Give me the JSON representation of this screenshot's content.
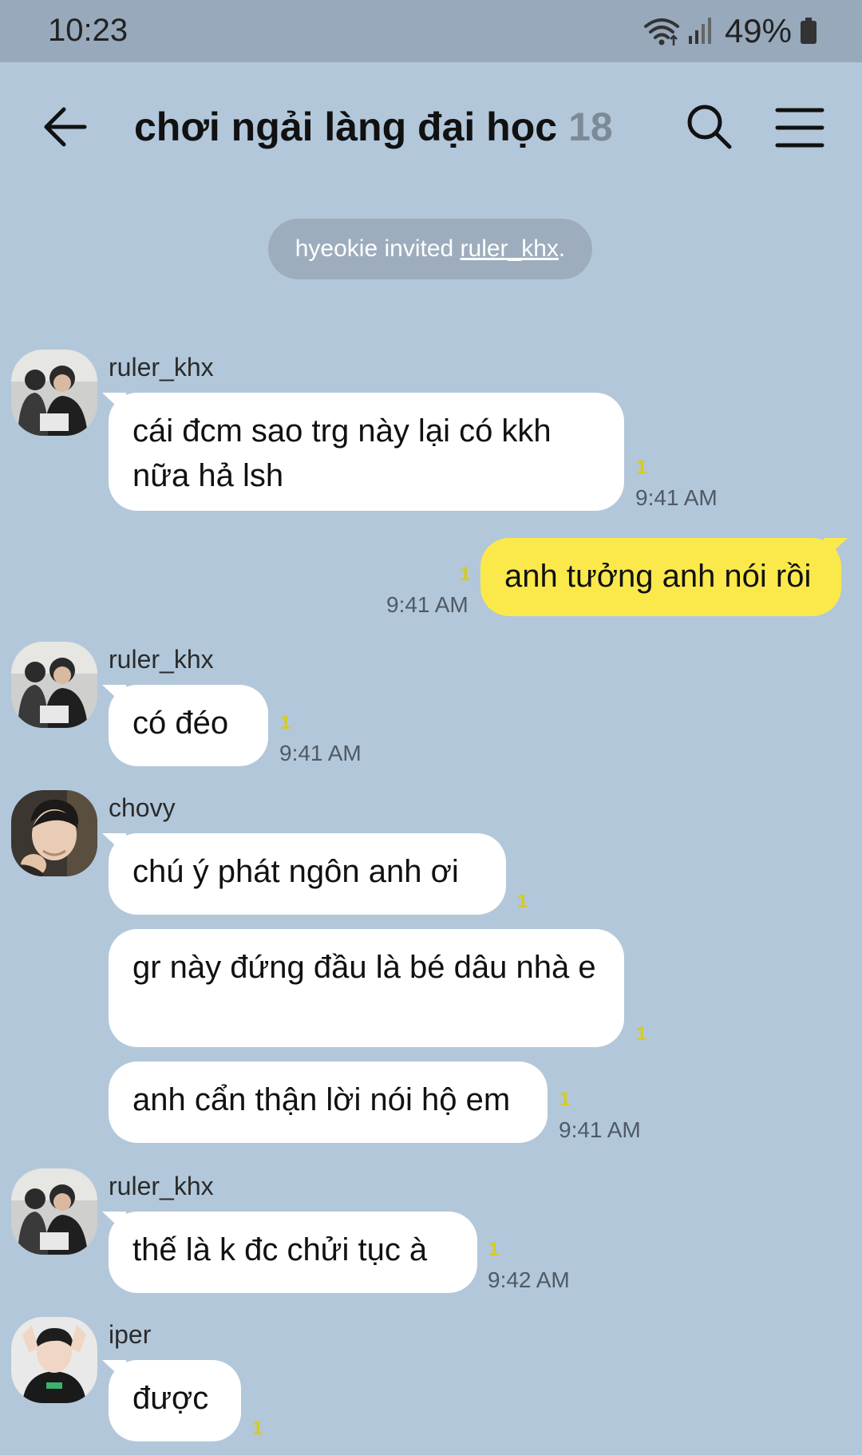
{
  "status_bar": {
    "time": "10:23",
    "battery": "49%",
    "icons": [
      "wifi-icon",
      "signal-icon",
      "battery-icon"
    ]
  },
  "header": {
    "title": "chơi ngải làng đại học",
    "member_count": "18",
    "icons": [
      "back-arrow-icon",
      "search-icon",
      "menu-icon"
    ]
  },
  "system_notice": {
    "inviter": "hyeokie",
    "text": " invited ",
    "invitee": "ruler_khx",
    "suffix": "."
  },
  "messages": [
    {
      "sender": "ruler_khx",
      "text": "cái đcm sao trg này lại có kkh nữa hả lsh",
      "unread": "1",
      "time": "9:41 AM"
    },
    {
      "sender": "me",
      "text": "anh tưởng anh nói rồi",
      "unread": "1",
      "time": "9:41 AM"
    },
    {
      "sender": "ruler_khx",
      "text": "có đéo",
      "unread": "1",
      "time": "9:41 AM"
    },
    {
      "sender": "chovy",
      "text": "chú ý phát ngôn anh ơi",
      "unread": "1",
      "time": ""
    },
    {
      "sender": "chovy",
      "text": "gr này đứng đầu là bé dâu nhà e",
      "unread": "1",
      "time": ""
    },
    {
      "sender": "chovy",
      "text": "anh cẩn thận lời nói hộ em",
      "unread": "1",
      "time": "9:41 AM"
    },
    {
      "sender": "ruler_khx",
      "text": "thế là k đc chửi tục à",
      "unread": "1",
      "time": "9:42 AM"
    },
    {
      "sender": "iper",
      "text": "được",
      "unread": "1",
      "time": ""
    }
  ],
  "colors": {
    "background": "#b2c7da",
    "status_bar": "#97a9bb",
    "my_bubble": "#fbe94b",
    "other_bubble": "#ffffff",
    "unread": "#d8cb1a"
  }
}
